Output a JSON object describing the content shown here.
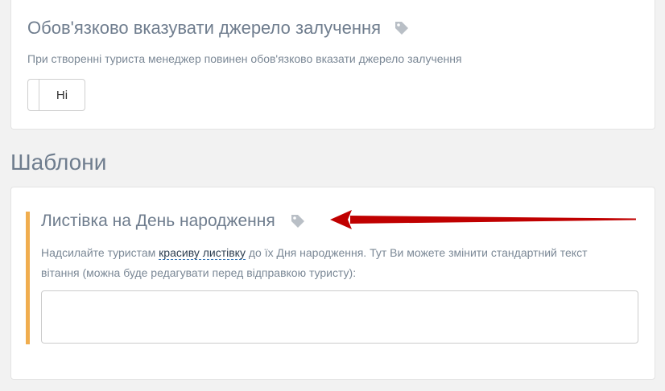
{
  "setting": {
    "title": "Обов'язково вказувати джерело залучення",
    "title_icon": "tag-icon",
    "description": "При створенні туриста менеджер повинен обов'язково вказати джерело залучення",
    "toggle_label": "Ні"
  },
  "section": {
    "heading": "Шаблони"
  },
  "template": {
    "title": "Листівка на День народження",
    "title_icon": "tag-icon",
    "desc_before": "Надсилайте туристам ",
    "desc_link": "красиву листівку",
    "desc_after": " до їх Дня народження. Тут Ви можете змінити стандартний текст вітання (можна буде редагувати перед відправкою туристу):",
    "textarea_value": ""
  },
  "colors": {
    "accent": "#f0ad4e",
    "arrow": "#c00000"
  }
}
